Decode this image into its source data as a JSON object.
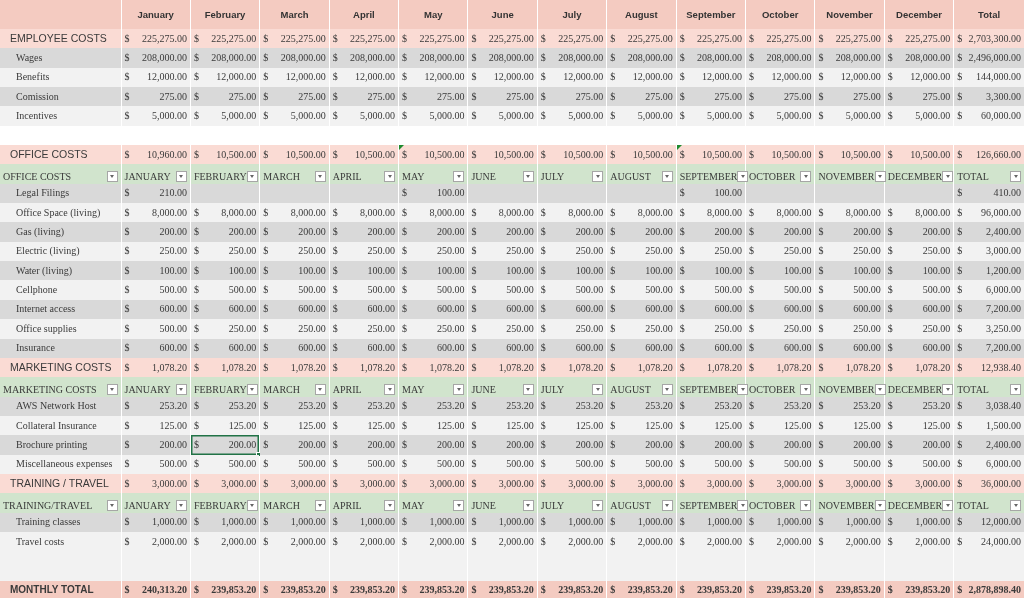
{
  "columns": [
    "January",
    "February",
    "March",
    "April",
    "May",
    "June",
    "July",
    "August",
    "September",
    "October",
    "November",
    "December",
    "Total"
  ],
  "rows": [
    {
      "kind": "summary",
      "label": "EMPLOYEE COSTS",
      "cells": [
        "$ 225,275.00",
        "$ 225,275.00",
        "$ 225,275.00",
        "$ 225,275.00",
        "$ 225,275.00",
        "$ 225,275.00",
        "$ 225,275.00",
        "$ 225,275.00",
        "$ 225,275.00",
        "$ 225,275.00",
        "$ 225,275.00",
        "$ 225,275.00",
        "$ 2,703,300.00"
      ]
    },
    {
      "kind": "item",
      "label": "Wages",
      "cells": [
        "$ 208,000.00",
        "$ 208,000.00",
        "$ 208,000.00",
        "$ 208,000.00",
        "$ 208,000.00",
        "$ 208,000.00",
        "$ 208,000.00",
        "$ 208,000.00",
        "$ 208,000.00",
        "$ 208,000.00",
        "$ 208,000.00",
        "$ 208,000.00",
        "$ 2,496,000.00"
      ]
    },
    {
      "kind": "item",
      "label": "Benefits",
      "cells": [
        "$ 12,000.00",
        "$ 12,000.00",
        "$ 12,000.00",
        "$ 12,000.00",
        "$ 12,000.00",
        "$ 12,000.00",
        "$ 12,000.00",
        "$ 12,000.00",
        "$ 12,000.00",
        "$ 12,000.00",
        "$ 12,000.00",
        "$ 12,000.00",
        "$ 144,000.00"
      ]
    },
    {
      "kind": "item",
      "label": "Comission",
      "cells": [
        "$ 275.00",
        "$ 275.00",
        "$ 275.00",
        "$ 275.00",
        "$ 275.00",
        "$ 275.00",
        "$ 275.00",
        "$ 275.00",
        "$ 275.00",
        "$ 275.00",
        "$ 275.00",
        "$ 275.00",
        "$ 3,300.00"
      ]
    },
    {
      "kind": "item",
      "label": "Incentives",
      "cells": [
        "$ 5,000.00",
        "$ 5,000.00",
        "$ 5,000.00",
        "$ 5,000.00",
        "$ 5,000.00",
        "$ 5,000.00",
        "$ 5,000.00",
        "$ 5,000.00",
        "$ 5,000.00",
        "$ 5,000.00",
        "$ 5,000.00",
        "$ 5,000.00",
        "$ 60,000.00"
      ]
    },
    {
      "kind": "blank"
    },
    {
      "kind": "summary",
      "label": "OFFICE COSTS",
      "cells": [
        "$ 10,960.00",
        "$ 10,500.00",
        "$ 10,500.00",
        "$ 10,500.00",
        {
          "text": "$ 10,500.00",
          "flag": true
        },
        "$ 10,500.00",
        "$ 10,500.00",
        "$ 10,500.00",
        {
          "text": "$ 10,500.00",
          "flag": true
        },
        "$ 10,500.00",
        "$ 10,500.00",
        "$ 10,500.00",
        "$ 126,660.00"
      ]
    },
    {
      "kind": "table_header",
      "label": "OFFICE COSTS",
      "cells": [
        "JANUARY",
        "FEBRUARY",
        "MARCH",
        "APRIL",
        "MAY",
        "JUNE",
        "JULY",
        "AUGUST",
        "SEPTEMBER",
        "OCTOBER",
        "NOVEMBER",
        "DECEMBER",
        "TOTAL"
      ]
    },
    {
      "kind": "item",
      "label": "Legal Filings",
      "cells": [
        "$ 210.00",
        null,
        null,
        null,
        "$ 100.00",
        null,
        null,
        null,
        "$ 100.00",
        null,
        null,
        null,
        "$ 410.00"
      ]
    },
    {
      "kind": "item",
      "label": "Office Space (living)",
      "cells": [
        "$ 8,000.00",
        "$ 8,000.00",
        "$ 8,000.00",
        "$ 8,000.00",
        "$ 8,000.00",
        "$ 8,000.00",
        "$ 8,000.00",
        "$ 8,000.00",
        "$ 8,000.00",
        "$ 8,000.00",
        "$ 8,000.00",
        "$ 8,000.00",
        "$ 96,000.00"
      ]
    },
    {
      "kind": "item",
      "label": "Gas (living)",
      "cells": [
        "$ 200.00",
        "$ 200.00",
        "$ 200.00",
        "$ 200.00",
        "$ 200.00",
        "$ 200.00",
        "$ 200.00",
        "$ 200.00",
        "$ 200.00",
        "$ 200.00",
        "$ 200.00",
        "$ 200.00",
        "$ 2,400.00"
      ]
    },
    {
      "kind": "item",
      "label": "Electric (living)",
      "cells": [
        "$ 250.00",
        "$ 250.00",
        "$ 250.00",
        "$ 250.00",
        "$ 250.00",
        "$ 250.00",
        "$ 250.00",
        "$ 250.00",
        "$ 250.00",
        "$ 250.00",
        "$ 250.00",
        "$ 250.00",
        "$ 3,000.00"
      ]
    },
    {
      "kind": "item",
      "label": "Water (living)",
      "cells": [
        "$ 100.00",
        "$ 100.00",
        "$ 100.00",
        "$ 100.00",
        "$ 100.00",
        "$ 100.00",
        "$ 100.00",
        "$ 100.00",
        "$ 100.00",
        "$ 100.00",
        "$ 100.00",
        "$ 100.00",
        "$ 1,200.00"
      ]
    },
    {
      "kind": "item",
      "label": "Cellphone",
      "cells": [
        "$ 500.00",
        "$ 500.00",
        "$ 500.00",
        "$ 500.00",
        "$ 500.00",
        "$ 500.00",
        "$ 500.00",
        "$ 500.00",
        "$ 500.00",
        "$ 500.00",
        "$ 500.00",
        "$ 500.00",
        "$ 6,000.00"
      ]
    },
    {
      "kind": "item",
      "label": "Internet access",
      "cells": [
        "$ 600.00",
        "$ 600.00",
        "$ 600.00",
        "$ 600.00",
        "$ 600.00",
        "$ 600.00",
        "$ 600.00",
        "$ 600.00",
        "$ 600.00",
        "$ 600.00",
        "$ 600.00",
        "$ 600.00",
        "$ 7,200.00"
      ]
    },
    {
      "kind": "item",
      "label": "Office supplies",
      "cells": [
        "$ 500.00",
        "$ 250.00",
        "$ 250.00",
        "$ 250.00",
        "$ 250.00",
        "$ 250.00",
        "$ 250.00",
        "$ 250.00",
        "$ 250.00",
        "$ 250.00",
        "$ 250.00",
        "$ 250.00",
        "$ 3,250.00"
      ]
    },
    {
      "kind": "item",
      "label": "Insurance",
      "cells": [
        "$ 600.00",
        "$ 600.00",
        "$ 600.00",
        "$ 600.00",
        "$ 600.00",
        "$ 600.00",
        "$ 600.00",
        "$ 600.00",
        "$ 600.00",
        "$ 600.00",
        "$ 600.00",
        "$ 600.00",
        "$ 7,200.00"
      ]
    },
    {
      "kind": "summary",
      "label": "MARKETING COSTS",
      "cells": [
        "$ 1,078.20",
        "$ 1,078.20",
        "$ 1,078.20",
        "$ 1,078.20",
        "$ 1,078.20",
        "$ 1,078.20",
        "$ 1,078.20",
        "$ 1,078.20",
        "$ 1,078.20",
        "$ 1,078.20",
        "$ 1,078.20",
        "$ 1,078.20",
        "$ 12,938.40"
      ]
    },
    {
      "kind": "table_header",
      "label": "MARKETING COSTS",
      "cells": [
        "JANUARY",
        "FEBRUARY",
        "MARCH",
        "APRIL",
        "MAY",
        "JUNE",
        "JULY",
        "AUGUST",
        "SEPTEMBER",
        "OCTOBER",
        "NOVEMBER",
        "DECEMBER",
        "TOTAL"
      ]
    },
    {
      "kind": "item",
      "label": "AWS Network Host",
      "cells": [
        "$ 253.20",
        "$ 253.20",
        "$ 253.20",
        "$ 253.20",
        "$ 253.20",
        "$ 253.20",
        "$ 253.20",
        "$ 253.20",
        "$ 253.20",
        "$ 253.20",
        "$ 253.20",
        "$ 253.20",
        "$ 3,038.40"
      ]
    },
    {
      "kind": "item",
      "label": "Collateral Insurance",
      "cells": [
        "$ 125.00",
        "$ 125.00",
        "$ 125.00",
        "$ 125.00",
        "$ 125.00",
        "$ 125.00",
        "$ 125.00",
        "$ 125.00",
        "$ 125.00",
        "$ 125.00",
        "$ 125.00",
        "$ 125.00",
        "$ 1,500.00"
      ]
    },
    {
      "kind": "item",
      "label": "Brochure printing",
      "cells": [
        "$ 200.00",
        {
          "text": "$ 200.00",
          "selected": true
        },
        "$ 200.00",
        "$ 200.00",
        "$ 200.00",
        "$ 200.00",
        "$ 200.00",
        "$ 200.00",
        "$ 200.00",
        "$ 200.00",
        "$ 200.00",
        "$ 200.00",
        "$ 2,400.00"
      ]
    },
    {
      "kind": "item",
      "label": "Miscellaneous expenses",
      "cells": [
        "$ 500.00",
        "$ 500.00",
        "$ 500.00",
        "$ 500.00",
        "$ 500.00",
        "$ 500.00",
        "$ 500.00",
        "$ 500.00",
        "$ 500.00",
        "$ 500.00",
        "$ 500.00",
        "$ 500.00",
        "$ 6,000.00"
      ]
    },
    {
      "kind": "summary",
      "label": "TRAINING / TRAVEL",
      "cells": [
        "$ 3,000.00",
        "$ 3,000.00",
        "$ 3,000.00",
        "$ 3,000.00",
        "$ 3,000.00",
        "$ 3,000.00",
        "$ 3,000.00",
        "$ 3,000.00",
        "$ 3,000.00",
        "$ 3,000.00",
        "$ 3,000.00",
        "$ 3,000.00",
        "$ 36,000.00"
      ]
    },
    {
      "kind": "table_header",
      "label": "TRAINING/TRAVEL",
      "cells": [
        "JANUARY",
        "FEBRUARY",
        "MARCH",
        "APRIL",
        "MAY",
        "JUNE",
        "JULY",
        "AUGUST",
        "SEPTEMBER",
        "OCTOBER",
        "NOVEMBER",
        "DECEMBER",
        "TOTAL"
      ]
    },
    {
      "kind": "item",
      "label": "Training classes",
      "cells": [
        "$ 1,000.00",
        "$ 1,000.00",
        "$ 1,000.00",
        "$ 1,000.00",
        "$ 1,000.00",
        "$ 1,000.00",
        "$ 1,000.00",
        "$ 1,000.00",
        "$ 1,000.00",
        "$ 1,000.00",
        "$ 1,000.00",
        "$ 1,000.00",
        "$ 12,000.00"
      ]
    },
    {
      "kind": "item",
      "label": "Travel costs",
      "cells": [
        "$ 2,000.00",
        "$ 2,000.00",
        "$ 2,000.00",
        "$ 2,000.00",
        "$ 2,000.00",
        "$ 2,000.00",
        "$ 2,000.00",
        "$ 2,000.00",
        "$ 2,000.00",
        "$ 2,000.00",
        "$ 2,000.00",
        "$ 2,000.00",
        "$ 24,000.00"
      ]
    },
    {
      "kind": "spacer"
    },
    {
      "kind": "grand_total",
      "label": "MONTHLY TOTAL",
      "cells": [
        "$ 240,313.20",
        "$ 239,853.20",
        "$ 239,853.20",
        "$ 239,853.20",
        "$ 239,853.20",
        "$ 239,853.20",
        "$ 239,853.20",
        "$ 239,853.20",
        "$ 239,853.20",
        "$ 239,853.20",
        "$ 239,853.20",
        "$ 239,853.20",
        "$ 2,878,898.40"
      ]
    }
  ]
}
